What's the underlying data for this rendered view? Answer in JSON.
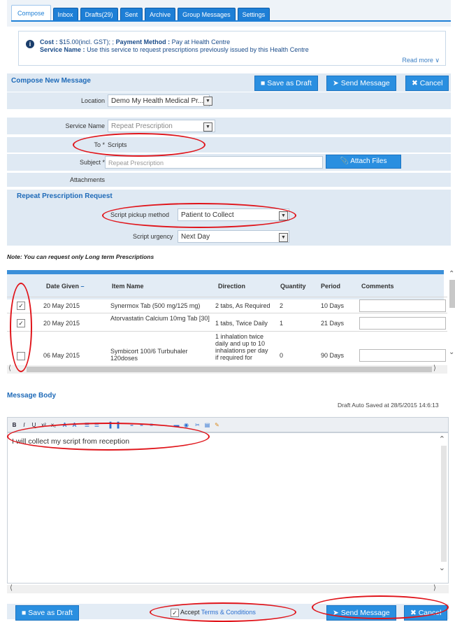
{
  "tabs": [
    {
      "label": "Compose",
      "active": true
    },
    {
      "label": "Inbox"
    },
    {
      "label": "Drafts(29)"
    },
    {
      "label": "Sent"
    },
    {
      "label": "Archive"
    },
    {
      "label": "Group Messages"
    },
    {
      "label": "Settings"
    }
  ],
  "info": {
    "cost_label": "Cost :",
    "cost_value": "$15.00(incl. GST); ;",
    "payment_label": "Payment Method :",
    "payment_value": "Pay at Health Centre",
    "service_label": "Service Name :",
    "service_value": "Use this service to request prescriptions previously issued by this Health Centre",
    "read_more": "Read more ∨"
  },
  "compose": {
    "title": "Compose New Message",
    "save_draft": "Save as Draft",
    "send": "Send Message",
    "cancel": "Cancel"
  },
  "form": {
    "location_label": "Location",
    "location_value": "Demo My Health Medical Pr...",
    "service_label": "Service Name",
    "service_value": "Repeat Prescription",
    "to_label": "To *",
    "to_value": "Scripts",
    "subject_label": "Subject *",
    "subject_value": "Repeat Prescription",
    "attach_label": "Attach Files",
    "attachments_label": "Attachments"
  },
  "repeat": {
    "title": "Repeat Prescription Request",
    "pickup_label": "Script pickup method",
    "pickup_value": "Patient to Collect",
    "urgency_label": "Script urgency",
    "urgency_value": "Next Day"
  },
  "note": "Note: You can request only Long term Prescriptions",
  "table": {
    "headers": [
      "Date Given",
      "Item Name",
      "Direction",
      "Quantity",
      "Period",
      "Comments"
    ],
    "rows": [
      {
        "checked": true,
        "date": "20 May 2015",
        "item": "Synermox Tab (500 mg/125 mg)",
        "direction": "2 tabs, As Required",
        "quantity": "2",
        "period": "10 Days"
      },
      {
        "checked": true,
        "date": "20 May 2015",
        "item": "Atorvastatin Calcium 10mg Tab [30]",
        "direction": "1 tabs, Twice Daily",
        "quantity": "1",
        "period": "21 Days"
      },
      {
        "checked": false,
        "date": "06 May 2015",
        "item": "Symbicort 100/6 Turbuhaler 120doses",
        "direction": "1 inhalation twice daily and up to 10 inhalations per day if required for",
        "quantity": "0",
        "period": "90 Days"
      }
    ]
  },
  "message": {
    "title": "Message Body",
    "autosave": "Draft Auto Saved at 28/5/2015 14:6:13",
    "body": "I will collect my script from reception",
    "toolbar": [
      "B",
      "I",
      "U",
      "x²",
      "x₂",
      "A",
      "A",
      "☰",
      "☰",
      "▐",
      "▌",
      "≡",
      "≡",
      "≡",
      "―",
      "▬",
      "◉",
      "✂",
      "▤",
      "✎"
    ]
  },
  "footer": {
    "save_draft": "Save as Draft",
    "accept_label": "Accept",
    "terms_link": "Terms & Conditions",
    "send": "Send Message",
    "cancel": "Cancel"
  },
  "colors": {
    "accent": "#2a8fe0",
    "annotation": "#e0141a",
    "panel": "#dfe9f3"
  }
}
